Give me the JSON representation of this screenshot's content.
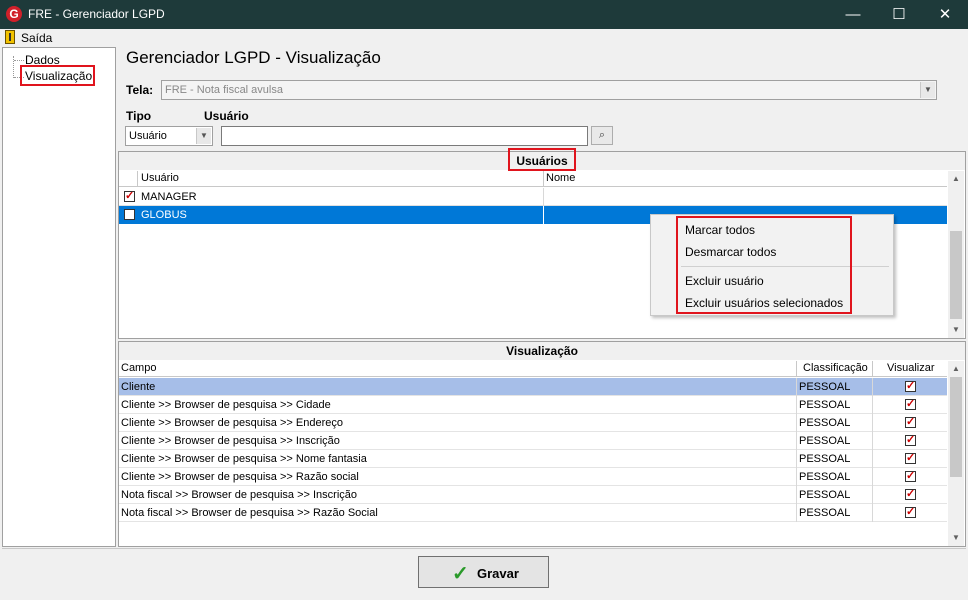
{
  "window": {
    "title": "FRE - Gerenciador LGPD",
    "minimize": "—",
    "maximize": "☐",
    "close": "✕"
  },
  "menu": {
    "exit_label": "Saída"
  },
  "tree": {
    "items": [
      {
        "label": "Dados"
      },
      {
        "label": "Visualização"
      }
    ]
  },
  "page": {
    "title": "Gerenciador LGPD - Visualização"
  },
  "form": {
    "tela_label": "Tela:",
    "tela_value": "FRE - Nota fiscal avulsa",
    "tipo_label": "Tipo",
    "usuario_label": "Usuário",
    "tipo_value": "Usuário",
    "usuario_value": ""
  },
  "users_panel": {
    "header": "Usuários",
    "columns": [
      "Usuário",
      "Nome"
    ],
    "rows": [
      {
        "checked": true,
        "usuario": "MANAGER",
        "nome": ""
      },
      {
        "checked": false,
        "usuario": "GLOBUS",
        "nome": "",
        "selected": true
      }
    ]
  },
  "context_menu": {
    "items": [
      "Marcar todos",
      "Desmarcar todos",
      "Excluir usuário",
      "Excluir usuários selecionados"
    ]
  },
  "view_panel": {
    "header": "Visualização",
    "columns": [
      "Campo",
      "Classificação",
      "Visualizar"
    ],
    "rows": [
      {
        "campo": "Cliente",
        "classificacao": "PESSOAL",
        "visualizar": true,
        "selected": true
      },
      {
        "campo": "Cliente >> Browser de pesquisa >> Cidade",
        "classificacao": "PESSOAL",
        "visualizar": true
      },
      {
        "campo": "Cliente >> Browser de pesquisa >> Endereço",
        "classificacao": "PESSOAL",
        "visualizar": true
      },
      {
        "campo": "Cliente >> Browser de pesquisa >> Inscrição",
        "classificacao": "PESSOAL",
        "visualizar": true
      },
      {
        "campo": "Cliente >> Browser de pesquisa >> Nome fantasia",
        "classificacao": "PESSOAL",
        "visualizar": true
      },
      {
        "campo": "Cliente >> Browser de pesquisa >> Razão social",
        "classificacao": "PESSOAL",
        "visualizar": true
      },
      {
        "campo": "Nota fiscal >> Browser de pesquisa >> Inscrição",
        "classificacao": "PESSOAL",
        "visualizar": true
      },
      {
        "campo": "Nota fiscal >> Browser de pesquisa >> Razão Social",
        "classificacao": "PESSOAL",
        "visualizar": true
      }
    ]
  },
  "actions": {
    "save_label": "Gravar"
  },
  "colors": {
    "titlebar": "#1e3a3a",
    "selection": "#0078d7",
    "row_highlight": "#a6bee8",
    "annotation": "#e0141d"
  },
  "icons": {
    "app": "app-logo-icon",
    "exit": "door-exit-icon",
    "search": "binoculars-icon",
    "save": "checkmark-icon"
  }
}
